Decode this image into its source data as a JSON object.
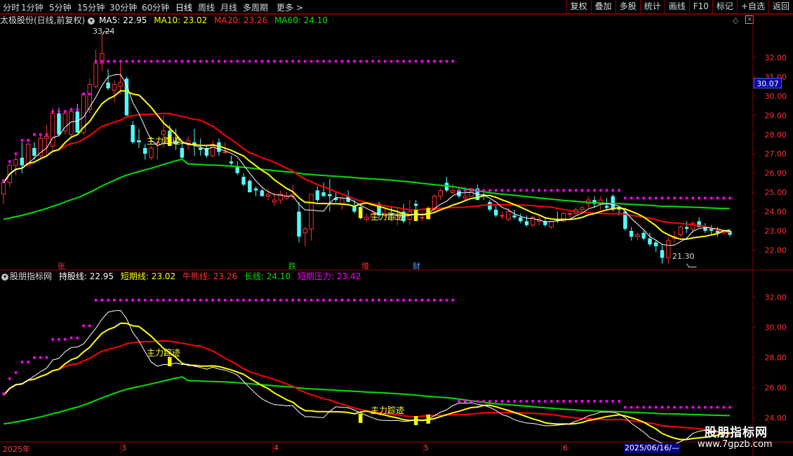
{
  "toolbar": {
    "periods": [
      "分时",
      "1分钟",
      "5分钟",
      "15分钟",
      "30分钟",
      "60分钟",
      "日线",
      "周线",
      "月线",
      "多周期",
      "更多 >"
    ],
    "active_period": "日线",
    "right_buttons": [
      "复权",
      "叠加",
      "多股",
      "统计",
      "画线",
      "F10",
      "标记",
      "+自选",
      "返回"
    ]
  },
  "main_header": {
    "stock_title": "太极股份(日线,前复权)",
    "ma5": "MA5: 22.95",
    "ma10": "MA10: 23.02",
    "ma20": "MA20: 23.26",
    "ma60": "MA60: 24.10",
    "icons": [
      "diamond-icon",
      "close-icon"
    ]
  },
  "sub_header": {
    "indicator_name": "股朋指标网",
    "hold": "持股线: 22.95",
    "short": "短期线: 23.02",
    "bull_bear": "牛熊线: 23.26",
    "long": "长线: 24.10",
    "pressure": "短期压力: 23.42"
  },
  "main_axis": [
    "32.00",
    "31.00",
    "30.00",
    "29.00",
    "28.00",
    "27.00",
    "26.00",
    "25.00",
    "24.00",
    "23.00",
    "22.00"
  ],
  "sub_axis": [
    "32.00",
    "30.00",
    "28.00",
    "26.00",
    "24.00"
  ],
  "current_price": "30.07",
  "annotations": {
    "high": "33.24",
    "low": "21.30",
    "track_label": "主力踪迹",
    "markers": [
      "张",
      "跌",
      "增",
      "财"
    ]
  },
  "time_axis": [
    "2025年",
    "3",
    "4",
    "5",
    "6"
  ],
  "cursor_date": "2025/06/16/—",
  "watermark": {
    "name": "股朋指标网",
    "url": "www.7gpzb.com"
  },
  "colors": {
    "up": "#ff3232",
    "down": "#54fcfc",
    "ma5": "#ffffff",
    "ma10": "#ffff00",
    "ma20": "#ff0000",
    "ma60": "#00e000",
    "pressure": "#ff00ff",
    "grid": "#8b0000"
  },
  "chart_data": [
    {
      "type": "candlestick",
      "candles": [
        [
          24.9,
          25.6,
          24.4,
          25.5
        ],
        [
          25.5,
          26.5,
          25.3,
          26.4
        ],
        [
          26.4,
          26.9,
          25.9,
          26.7
        ],
        [
          26.8,
          27.6,
          26.0,
          26.4
        ],
        [
          26.4,
          27.6,
          26.3,
          27.5
        ],
        [
          27.3,
          27.6,
          26.7,
          26.9
        ],
        [
          26.9,
          28.0,
          26.8,
          27.8
        ],
        [
          27.8,
          28.5,
          27.0,
          27.9
        ],
        [
          27.4,
          29.4,
          27.2,
          29.1
        ],
        [
          29.1,
          29.4,
          27.9,
          28.0
        ],
        [
          28.2,
          29.3,
          28.0,
          29.1
        ],
        [
          28.0,
          29.4,
          27.9,
          29.2
        ],
        [
          29.2,
          29.6,
          28.1,
          28.1
        ],
        [
          28.1,
          30.2,
          28.0,
          30.1
        ],
        [
          29.3,
          30.9,
          29.1,
          30.6
        ],
        [
          30.5,
          32.4,
          30.4,
          31.7
        ],
        [
          31.7,
          33.24,
          31.3,
          32.2
        ],
        [
          30.7,
          31.4,
          30.3,
          30.4
        ],
        [
          30.3,
          30.8,
          29.7,
          30.6
        ],
        [
          30.5,
          31.8,
          30.1,
          30.7
        ],
        [
          30.9,
          31.0,
          28.9,
          29.0
        ],
        [
          28.5,
          28.7,
          27.5,
          27.6
        ],
        [
          27.7,
          28.3,
          27.3,
          27.6
        ],
        [
          27.3,
          27.5,
          26.7,
          27.0
        ],
        [
          26.8,
          27.4,
          26.7,
          27.3
        ],
        [
          27.5,
          27.6,
          26.7,
          27.6
        ],
        [
          28.0,
          29.0,
          27.3,
          28.2
        ],
        [
          28.2,
          28.5,
          27.4,
          27.6
        ],
        [
          27.6,
          28.3,
          27.2,
          27.5
        ],
        [
          27.3,
          27.6,
          26.7,
          26.8
        ],
        [
          27.5,
          27.9,
          27.2,
          27.7
        ],
        [
          27.6,
          28.3,
          26.9,
          27.5
        ],
        [
          27.3,
          27.8,
          26.9,
          27.2
        ],
        [
          27.3,
          27.4,
          26.8,
          26.9
        ],
        [
          26.9,
          27.7,
          26.8,
          27.5
        ],
        [
          27.6,
          27.8,
          26.9,
          27.1
        ],
        [
          27.1,
          27.6,
          27.0,
          27.1
        ],
        [
          26.6,
          26.9,
          26.4,
          26.5
        ],
        [
          26.3,
          26.6,
          25.9,
          26.0
        ],
        [
          25.8,
          26.0,
          25.3,
          25.4
        ],
        [
          25.6,
          25.7,
          25.0,
          25.0
        ],
        [
          25.2,
          25.3,
          24.8,
          25.1
        ],
        [
          25.1,
          25.2,
          24.8,
          24.8
        ],
        [
          24.8,
          25.2,
          24.6,
          24.9
        ],
        [
          24.5,
          25.0,
          24.3,
          24.6
        ],
        [
          24.6,
          25.1,
          24.4,
          24.9
        ],
        [
          24.7,
          25.0,
          24.6,
          24.8
        ],
        [
          24.8,
          25.4,
          24.6,
          24.9
        ],
        [
          24.0,
          24.5,
          22.4,
          22.7
        ],
        [
          22.9,
          23.2,
          22.2,
          23.1
        ],
        [
          23.1,
          24.9,
          22.5,
          24.9
        ],
        [
          25.1,
          25.3,
          24.5,
          24.6
        ],
        [
          25.0,
          25.5,
          24.8,
          24.8
        ],
        [
          24.9,
          25.7,
          24.0,
          24.8
        ],
        [
          24.7,
          25.0,
          24.5,
          24.6
        ],
        [
          24.4,
          24.8,
          24.1,
          24.7
        ],
        [
          24.8,
          25.1,
          24.5,
          24.5
        ],
        [
          24.3,
          24.6,
          23.9,
          24.0
        ],
        [
          24.1,
          24.4,
          23.6,
          23.9
        ],
        [
          23.6,
          23.9,
          23.5,
          23.7
        ],
        [
          23.7,
          24.1,
          23.6,
          23.9
        ],
        [
          24.4,
          24.5,
          23.6,
          23.8
        ],
        [
          23.8,
          24.2,
          23.7,
          23.9
        ],
        [
          23.9,
          24.3,
          23.5,
          23.8
        ],
        [
          23.6,
          24.2,
          23.3,
          23.8
        ],
        [
          24.0,
          24.4,
          23.4,
          23.5
        ],
        [
          23.6,
          24.6,
          23.3,
          24.0
        ],
        [
          24.4,
          24.6,
          23.8,
          24.3
        ],
        [
          23.7,
          24.0,
          23.5,
          23.7
        ],
        [
          23.7,
          24.3,
          23.7,
          24.0
        ],
        [
          24.1,
          24.9,
          24.0,
          24.8
        ],
        [
          24.8,
          25.2,
          24.6,
          25.1
        ],
        [
          25.5,
          25.8,
          25.0,
          25.1
        ],
        [
          25.0,
          25.4,
          24.9,
          25.1
        ],
        [
          25.1,
          25.2,
          24.7,
          24.8
        ],
        [
          24.7,
          25.3,
          24.6,
          24.8
        ],
        [
          24.8,
          25.2,
          24.8,
          25.2
        ],
        [
          25.2,
          25.4,
          24.6,
          24.6
        ],
        [
          24.9,
          25.0,
          24.6,
          24.8
        ],
        [
          24.5,
          24.6,
          24.0,
          24.1
        ],
        [
          24.1,
          24.3,
          23.7,
          23.8
        ],
        [
          23.8,
          24.0,
          23.6,
          23.8
        ],
        [
          23.6,
          24.2,
          23.5,
          24.0
        ],
        [
          23.8,
          24.1,
          23.6,
          23.7
        ],
        [
          23.7,
          23.9,
          23.4,
          23.5
        ],
        [
          23.5,
          23.8,
          23.2,
          23.3
        ],
        [
          23.3,
          23.8,
          23.2,
          23.7
        ],
        [
          23.5,
          23.8,
          23.3,
          23.6
        ],
        [
          23.5,
          23.7,
          23.2,
          23.3
        ],
        [
          23.2,
          23.5,
          23.1,
          23.5
        ],
        [
          23.6,
          24.0,
          23.4,
          23.5
        ],
        [
          23.5,
          24.0,
          23.5,
          23.9
        ],
        [
          23.9,
          24.0,
          23.7,
          23.9
        ],
        [
          23.9,
          24.2,
          23.8,
          24.1
        ],
        [
          24.1,
          24.3,
          23.9,
          24.2
        ],
        [
          24.4,
          24.8,
          24.2,
          24.6
        ],
        [
          24.6,
          24.8,
          24.2,
          24.4
        ],
        [
          24.4,
          24.8,
          24.1,
          24.6
        ],
        [
          24.3,
          24.7,
          24.1,
          24.2
        ],
        [
          24.8,
          24.9,
          24.0,
          24.1
        ],
        [
          24.2,
          24.3,
          23.8,
          24.1
        ],
        [
          24.0,
          24.2,
          23.0,
          23.1
        ],
        [
          23.0,
          23.2,
          22.5,
          22.7
        ],
        [
          22.7,
          22.9,
          22.5,
          22.8
        ],
        [
          22.9,
          23.0,
          22.5,
          22.6
        ],
        [
          22.6,
          22.9,
          22.2,
          22.3
        ],
        [
          22.4,
          22.5,
          21.9,
          22.2
        ],
        [
          22.0,
          22.3,
          21.3,
          21.6
        ],
        [
          21.6,
          22.7,
          21.3,
          22.5
        ],
        [
          22.6,
          23.0,
          22.4,
          22.7
        ],
        [
          22.8,
          23.3,
          22.7,
          23.2
        ],
        [
          23.2,
          23.5,
          22.9,
          23.1
        ],
        [
          23.1,
          23.5,
          22.9,
          23.4
        ],
        [
          23.5,
          23.7,
          23.2,
          23.2
        ],
        [
          23.2,
          23.4,
          22.9,
          23.0
        ],
        [
          23.1,
          23.3,
          22.8,
          23.0
        ],
        [
          23.0,
          23.2,
          22.7,
          22.9
        ],
        [
          22.9,
          23.1,
          22.8,
          23.0
        ],
        [
          23.0,
          23.1,
          22.7,
          22.8
        ]
      ],
      "ylim": [
        21.0,
        33.6
      ],
      "series_names": [
        "MA5",
        "MA10",
        "MA20",
        "MA60"
      ]
    },
    {
      "type": "line",
      "series_names": [
        "持股线",
        "短期线",
        "牛熊线",
        "长线",
        "短期压力"
      ],
      "ylim": [
        22.5,
        33.0
      ]
    }
  ]
}
